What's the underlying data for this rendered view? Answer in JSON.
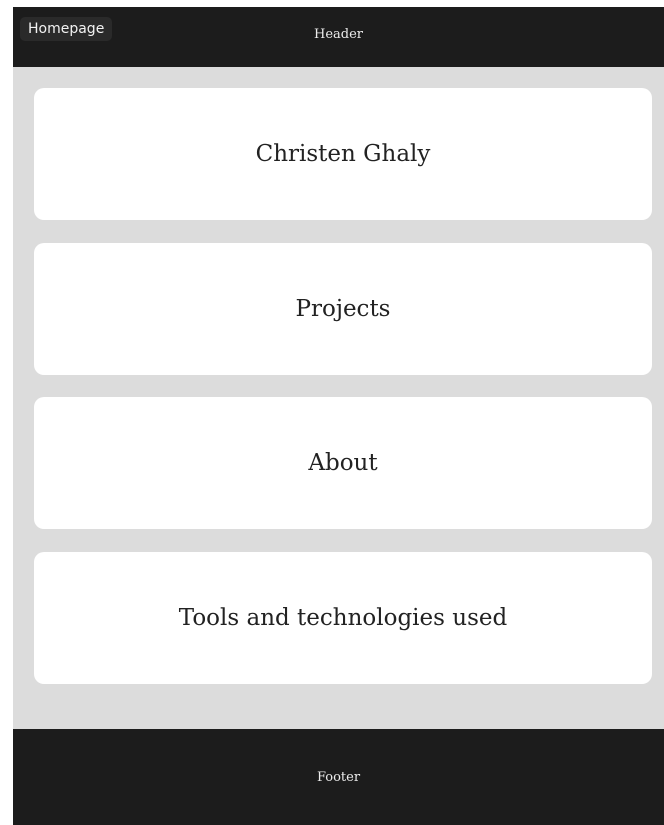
{
  "header": {
    "home_button_label": "Homepage",
    "title": "Header"
  },
  "main": {
    "cards": [
      {
        "label": "Christen Ghaly"
      },
      {
        "label": "Projects"
      },
      {
        "label": "About"
      },
      {
        "label": "Tools and technologies used"
      }
    ]
  },
  "footer": {
    "text": "Footer"
  },
  "colors": {
    "header_bg": "#1c1c1c",
    "footer_bg": "#1c1c1c",
    "page_bg": "#dcdcdc",
    "card_bg": "#ffffff"
  }
}
